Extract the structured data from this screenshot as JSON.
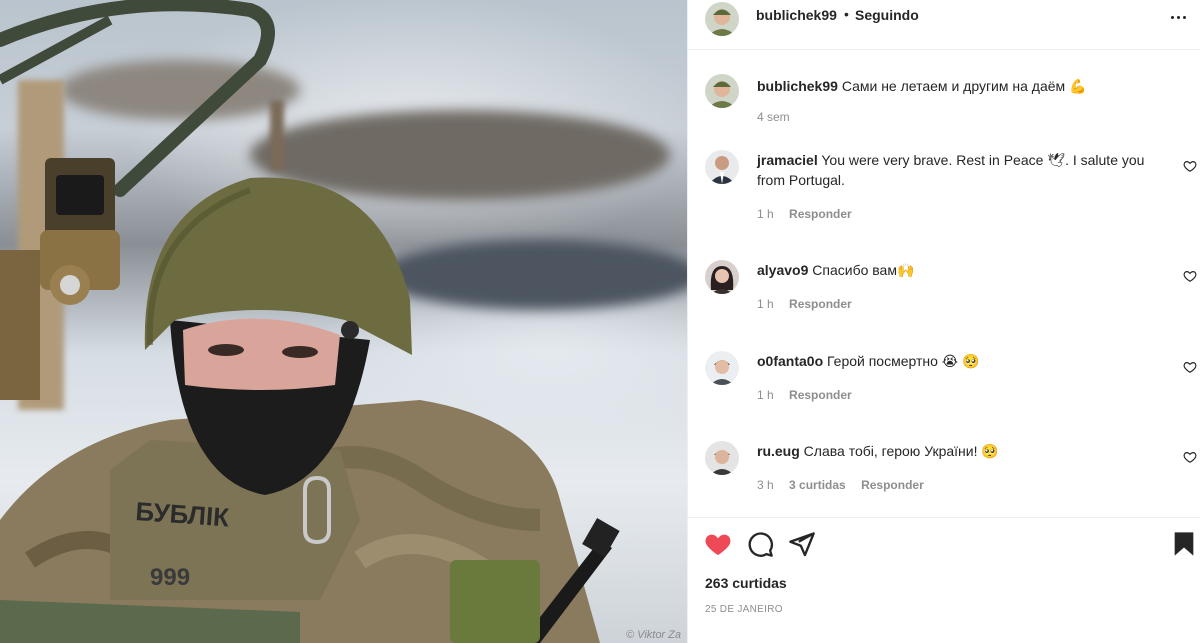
{
  "post": {
    "author": "bublichek99",
    "follow_separator": "•",
    "follow_status": "Seguindo",
    "watermark": "© Viktor Za"
  },
  "caption": {
    "username": "bublichek99",
    "text": "Сами не летаем и другим на даём 💪",
    "time": "4 sem"
  },
  "comments": [
    {
      "username": "jramaciel",
      "text": "You were very brave. Rest in Peace 🕊. I salute you from Portugal.",
      "time": "1 h",
      "reply": "Responder",
      "likes": ""
    },
    {
      "username": "alyavo9",
      "text": "Спасибо вам🙌",
      "time": "1 h",
      "reply": "Responder",
      "likes": ""
    },
    {
      "username": "o0fanta0o",
      "text": "Герой посмертно 😭 🥺",
      "time": "1 h",
      "reply": "Responder",
      "likes": ""
    },
    {
      "username": "ru.eug",
      "text": "Слава тобі, герою України! 🥺",
      "time": "3 h",
      "reply": "Responder",
      "likes": "3 curtidas"
    }
  ],
  "stats": {
    "likes": "263 curtidas",
    "date": "25 DE JANEIRO"
  },
  "colors": {
    "like_active": "#ed4956",
    "text": "#262626",
    "muted": "#8e8e8e"
  },
  "icons": [
    "heart-filled-icon",
    "comment-icon",
    "share-icon",
    "bookmark-icon",
    "more-options-icon",
    "heart-outline-icon"
  ]
}
